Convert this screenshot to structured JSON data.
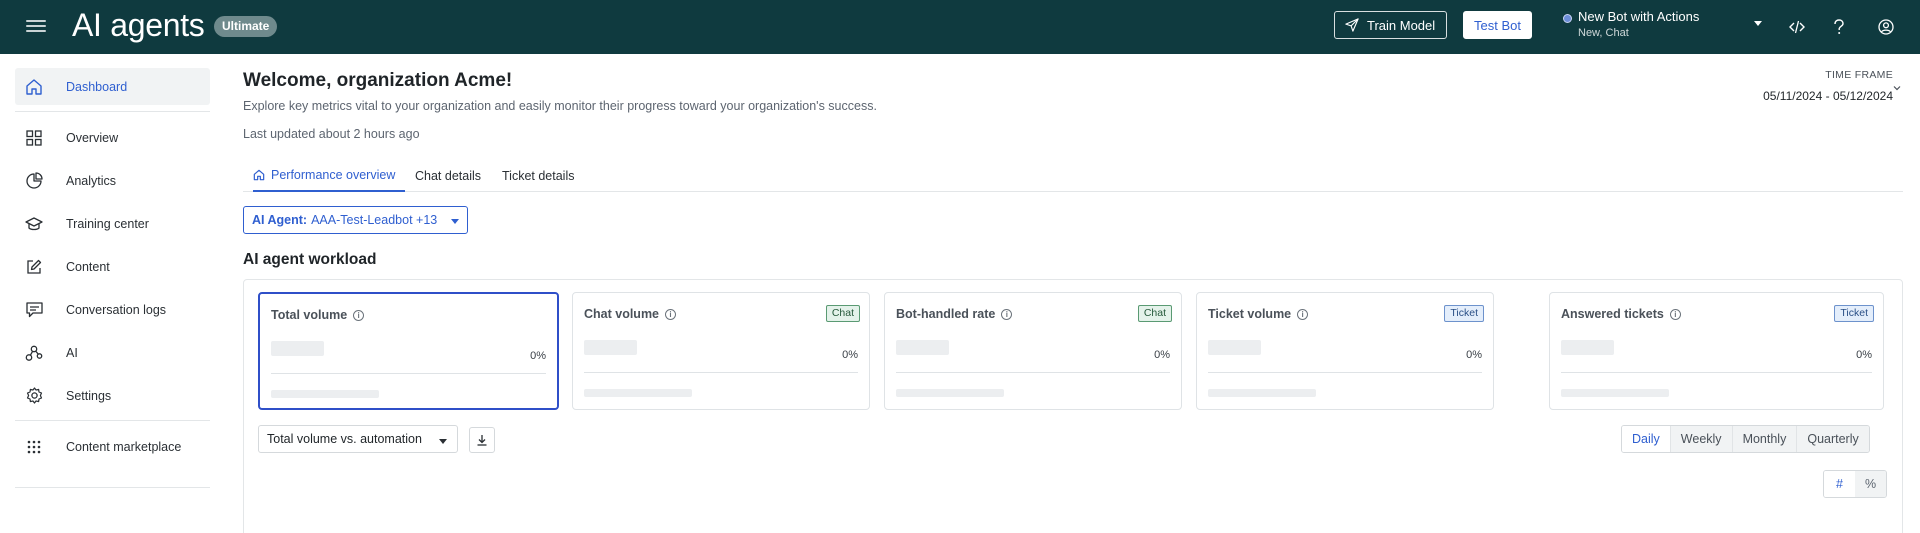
{
  "header": {
    "app_title": "AI agents",
    "plan_badge": "Ultimate",
    "train_model_label": "Train Model",
    "test_bot_label": "Test Bot",
    "bot": {
      "name": "New Bot with Actions",
      "subtitle": "New, Chat"
    },
    "background_color": "#0f3a3f"
  },
  "sidebar": {
    "items": [
      {
        "label": "Dashboard",
        "icon": "home-icon",
        "active": true
      },
      {
        "label": "Overview",
        "icon": "grid-icon"
      },
      {
        "label": "Analytics",
        "icon": "pie-chart-icon"
      },
      {
        "label": "Training center",
        "icon": "graduation-cap-icon"
      },
      {
        "label": "Content",
        "icon": "edit-icon"
      },
      {
        "label": "Conversation logs",
        "icon": "chat-bubble-icon"
      },
      {
        "label": "AI",
        "icon": "nodes-icon"
      },
      {
        "label": "Settings",
        "icon": "gear-icon"
      },
      {
        "label": "Content marketplace",
        "icon": "dots-grid-icon"
      }
    ]
  },
  "main": {
    "welcome": "Welcome, organization Acme!",
    "subtitle": "Explore key metrics vital to your organization and easily monitor their progress toward your organization's success.",
    "last_updated": "Last updated about 2 hours ago",
    "time_frame": {
      "label": "TIME FRAME",
      "value": "05/11/2024 - 05/12/2024"
    },
    "tabs": [
      {
        "label": "Performance overview",
        "active": true
      },
      {
        "label": "Chat details"
      },
      {
        "label": "Ticket details"
      }
    ],
    "agent_filter": {
      "label": "AI Agent:",
      "value": "AAA-Test-Leadbot +13"
    },
    "section_title": "AI agent workload",
    "metric_cards": [
      {
        "title": "Total volume",
        "tag": "",
        "pct": "0%",
        "selected": true
      },
      {
        "title": "Chat volume",
        "tag": "Chat",
        "pct": "0%"
      },
      {
        "title": "Bot-handled rate",
        "tag": "Chat",
        "pct": "0%"
      },
      {
        "title": "Ticket volume",
        "tag": "Ticket",
        "pct": "0%"
      },
      {
        "title": "Answered tickets",
        "tag": "Ticket",
        "pct": "0%"
      }
    ],
    "metric_select": "Total volume vs. automation",
    "periods": [
      {
        "label": "Daily",
        "active": true
      },
      {
        "label": "Weekly"
      },
      {
        "label": "Monthly"
      },
      {
        "label": "Quarterly"
      }
    ],
    "units": [
      {
        "label": "#",
        "active": true
      },
      {
        "label": "%"
      }
    ],
    "accent_color": "#2f5fd0"
  }
}
